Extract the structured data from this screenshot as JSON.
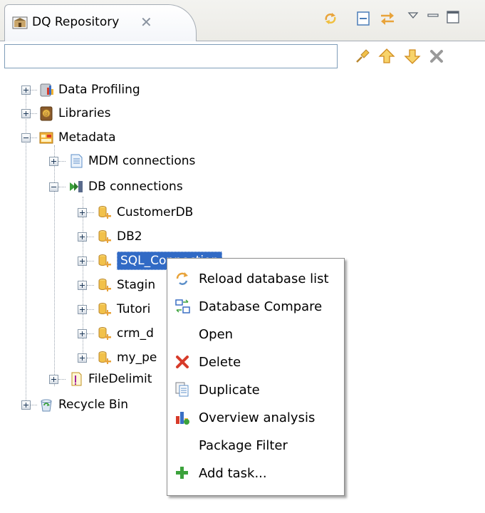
{
  "view": {
    "title": "DQ Repository",
    "filter": {
      "value": "",
      "placeholder": ""
    }
  },
  "tree": {
    "data_profiling": "Data Profiling",
    "libraries": "Libraries",
    "metadata": "Metadata",
    "mdm_connections": "MDM connections",
    "db_connections": "DB connections",
    "connections": [
      "CustomerDB",
      "DB2",
      "SQL_Connection",
      "Stagin",
      "Tutori",
      "crm_d",
      "my_pe"
    ],
    "file_delimited": "FileDelimit",
    "recycle_bin": "Recycle Bin"
  },
  "context_menu": {
    "items": [
      {
        "label": "Reload database list",
        "icon": "reload-icon"
      },
      {
        "label": "Database Compare",
        "icon": "compare-icon"
      },
      {
        "label": "Open",
        "icon": ""
      },
      {
        "label": "Delete",
        "icon": "delete-icon"
      },
      {
        "label": "Duplicate",
        "icon": "duplicate-icon"
      },
      {
        "label": "Overview analysis",
        "icon": "analysis-icon"
      },
      {
        "label": "Package Filter",
        "icon": ""
      },
      {
        "label": "Add task...",
        "icon": "add-task-icon"
      }
    ]
  },
  "colors": {
    "selection": "#316ac5",
    "accent_orange": "#e8a33a",
    "delete_red": "#d73b2a",
    "add_green": "#3ca23c"
  }
}
